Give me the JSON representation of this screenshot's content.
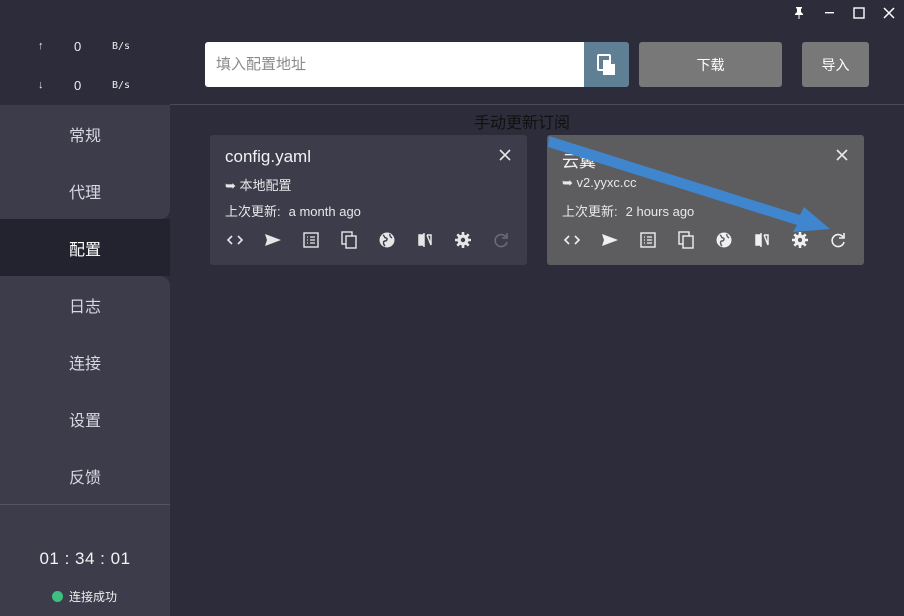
{
  "titlebar": {
    "pin_icon": "pin-icon",
    "minimize_icon": "minimize-icon",
    "maximize_icon": "maximize-icon",
    "close_icon": "close-icon"
  },
  "sidebar": {
    "upload": {
      "arrow": "↑",
      "value": "0",
      "unit": "B/s"
    },
    "download": {
      "arrow": "↓",
      "value": "0",
      "unit": "B/s"
    },
    "items": [
      {
        "label": "常规"
      },
      {
        "label": "代理"
      },
      {
        "label": "配置"
      },
      {
        "label": "日志"
      },
      {
        "label": "连接"
      },
      {
        "label": "设置"
      },
      {
        "label": "反馈"
      }
    ],
    "active_index": 2,
    "clock": "01 : 34 : 01",
    "status": "连接成功",
    "status_color": "#3fbf7f"
  },
  "toolbar": {
    "url_placeholder": "填入配置地址",
    "url_value": "",
    "download_label": "下载",
    "import_label": "导入"
  },
  "profiles": [
    {
      "title": "config.yaml",
      "source": "➥ 本地配置",
      "updated_label": "上次更新:",
      "updated_value": "a month ago"
    },
    {
      "title": "云翼",
      "source": "➥ v2.yyxc.cc",
      "updated_label": "上次更新:",
      "updated_value": "2 hours ago"
    }
  ],
  "annotation": {
    "text": "手动更新订阅",
    "arrow_color": "#3f86cf"
  },
  "colors": {
    "accent": "#5f7f94",
    "background": "#2c2c3b",
    "sidebar": "#3c3c4b"
  }
}
